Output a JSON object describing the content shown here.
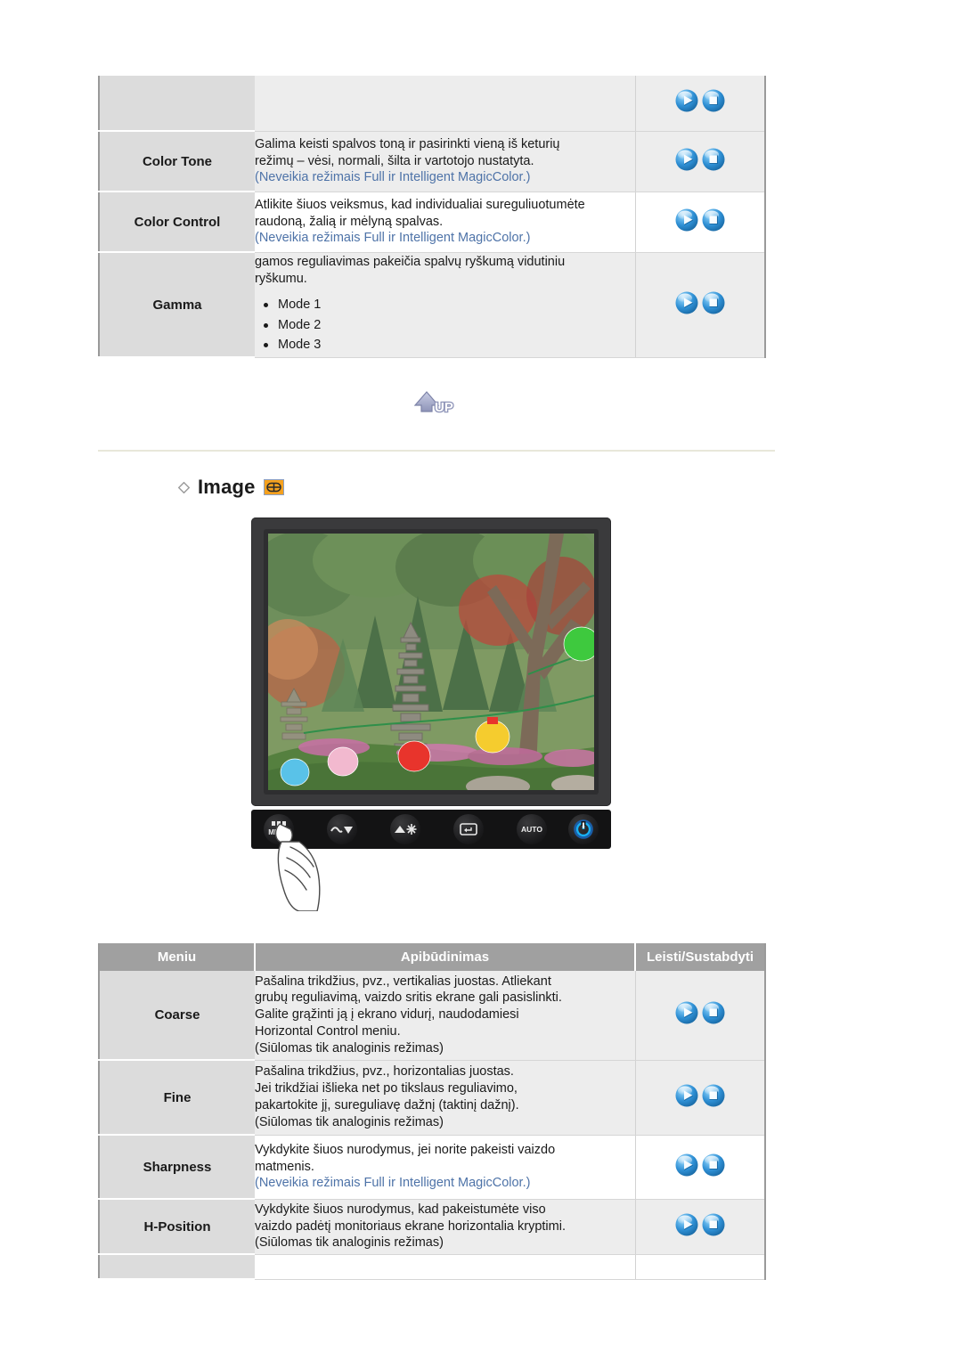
{
  "page": {
    "language_note": "Lithuanian Samsung monitor OSD manual page"
  },
  "top_table": {
    "rows": [
      {
        "menu": "",
        "desc_lines": [],
        "note": "",
        "bullets": [],
        "play_label": "play-icon",
        "stop_label": "stop-icon",
        "shade": "gray"
      },
      {
        "menu": "Color Tone",
        "desc_lines": [
          "Galima keisti spalvos toną ir pasirinkti vieną iš keturių",
          "režimų – vėsi, normali, šilta ir vartotojo nustatyta."
        ],
        "note": "(Neveikia režimais Full ir Intelligent MagicColor.)",
        "bullets": [],
        "play_label": "play-icon",
        "stop_label": "stop-icon",
        "shade": "gray"
      },
      {
        "menu": "Color Control",
        "desc_lines": [
          "Atlikite šiuos veiksmus, kad individualiai sureguliuotumėte",
          "raudoną, žalią ir mėlyną spalvas."
        ],
        "note": "(Neveikia režimais Full ir Intelligent MagicColor.)",
        "bullets": [],
        "play_label": "play-icon",
        "stop_label": "stop-icon",
        "shade": "white"
      },
      {
        "menu": "Gamma",
        "desc_lines": [
          "gamos reguliavimas pakeičia spalvų ryškumą vidutiniu",
          "ryškumu."
        ],
        "note": "",
        "bullets": [
          "Mode 1",
          "Mode 2",
          "Mode 3"
        ],
        "play_label": "play-icon",
        "stop_label": "stop-icon",
        "shade": "gray"
      }
    ]
  },
  "up_button": {
    "label": "UP",
    "name": "up-button"
  },
  "section": {
    "title": "Image",
    "badge_name": "image-osd-icon"
  },
  "monitor": {
    "buttons": [
      {
        "name": "menu-button",
        "label": "MENU",
        "sub": ""
      },
      {
        "name": "down-volume-button",
        "label": "",
        "sub": ""
      },
      {
        "name": "up-brightness-button",
        "label": "",
        "sub": ""
      },
      {
        "name": "enter-source-button",
        "label": "",
        "sub": ""
      },
      {
        "name": "auto-button",
        "label": "AUTO",
        "sub": ""
      },
      {
        "name": "power-button",
        "label": "",
        "sub": ""
      }
    ]
  },
  "bottom_table": {
    "headers": [
      "Meniu",
      "Apibūdinimas",
      "Leisti/Sustabdyti"
    ],
    "rows": [
      {
        "menu": "Coarse",
        "desc_lines": [
          "Pašalina trikdžius, pvz., vertikalias juostas. Atliekant",
          "grubų reguliavimą, vaizdo sritis ekrane gali pasislinkti.",
          "Galite grąžinti ją į ekrano vidurį, naudodamiesi",
          "Horizontal Control meniu.",
          "(Siūlomas tik analoginis režimas)"
        ],
        "note": "",
        "play_label": "play-icon",
        "stop_label": "stop-icon",
        "shade": "gray"
      },
      {
        "menu": "Fine",
        "desc_lines": [
          "Pašalina trikdžius, pvz., horizontalias juostas.",
          "Jei trikdžiai išlieka net po tikslaus reguliavimo,",
          "pakartokite jį, sureguliavę dažnį (taktinį dažnį).",
          "(Siūlomas tik analoginis režimas)"
        ],
        "note": "",
        "play_label": "play-icon",
        "stop_label": "stop-icon",
        "shade": "gray"
      },
      {
        "menu": "Sharpness",
        "desc_lines": [
          "Vykdykite šiuos nurodymus, jei norite pakeisti vaizdo",
          "matmenis."
        ],
        "note": "(Neveikia režimais Full ir Intelligent MagicColor.)",
        "play_label": "play-icon",
        "stop_label": "stop-icon",
        "shade": "white"
      },
      {
        "menu": "H-Position",
        "desc_lines": [
          "Vykdykite šiuos nurodymus, kad pakeistumėte viso",
          "vaizdo padėtį monitoriaus ekrane horizontalia kryptimi.",
          "(Siūlomas tik analoginis režimas)"
        ],
        "note": "",
        "play_label": "play-icon",
        "stop_label": "stop-icon",
        "shade": "gray"
      },
      {
        "menu": "",
        "desc_lines": [],
        "note": "",
        "play_label": "",
        "stop_label": "",
        "shade": "white"
      }
    ]
  },
  "colors": {
    "menu_cell_bg": "#dcdcdc",
    "row_gray_bg": "#ededed",
    "header_bg": "#a0a0a0",
    "link_blue": "#4e73a8",
    "badge_orange": "#f5a11e",
    "divider": "#e8e7da",
    "button_blue": "#2f8fd6"
  }
}
